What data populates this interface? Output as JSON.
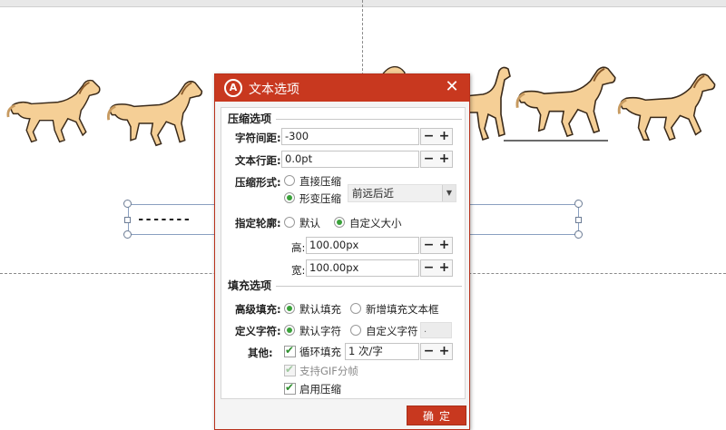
{
  "slide": {
    "textbox_text": "-------"
  },
  "dialog": {
    "logo": "A",
    "title": "文本选项",
    "close_icon": "✕",
    "compress_section": {
      "title": "压缩选项",
      "char_spacing": {
        "label": "字符间距:",
        "value": "-300"
      },
      "line_spacing": {
        "label": "文本行距:",
        "value": "0.0pt"
      },
      "compress_form": {
        "label": "压缩形式:",
        "options": [
          "直接压缩",
          "形变压缩"
        ],
        "selected": "形变压缩",
        "dropdown_value": "前远后近"
      },
      "outline": {
        "label": "指定轮廓:",
        "options": [
          "默认",
          "自定义大小"
        ],
        "selected": "自定义大小",
        "height": {
          "label": "高:",
          "value": "100.00px"
        },
        "width": {
          "label": "宽:",
          "value": "100.00px"
        }
      }
    },
    "fill_section": {
      "title": "填充选项",
      "advanced_fill": {
        "label": "高级填充:",
        "options": [
          "默认填充",
          "新增填充文本框"
        ],
        "selected": "默认填充"
      },
      "define_char": {
        "label": "定义字符:",
        "options": [
          "默认字符",
          "自定义字符"
        ],
        "selected": "默认字符",
        "custom_value": "."
      },
      "other": {
        "label": "其他:",
        "loop_fill": {
          "label": "循环填充",
          "checked": true,
          "value": "1 次/字"
        },
        "gif_frames": {
          "label": "支持GIF分帧",
          "checked": true,
          "disabled": true
        },
        "enable_compress": {
          "label": "启用压缩",
          "checked": true
        }
      }
    },
    "spin_minus": "−",
    "spin_plus": "+",
    "ok_label": "确定"
  },
  "colors": {
    "accent": "#c8381f",
    "radio_on": "#3aa13a",
    "horse_body": "#f5cf96",
    "horse_outline": "#3a2a1a"
  },
  "icons": [
    "logo-icon",
    "close-icon",
    "dropdown-arrow-icon",
    "horse-illustration"
  ]
}
